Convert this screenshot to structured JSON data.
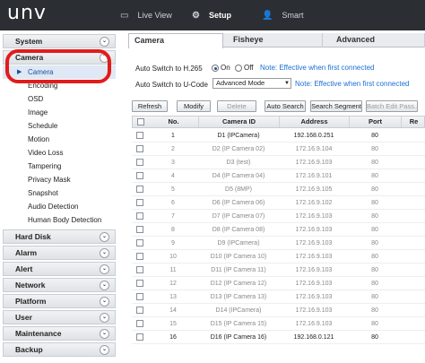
{
  "app": {
    "logo": "unv"
  },
  "topnav": [
    {
      "icon": "monitor-icon",
      "label": "Live View"
    },
    {
      "icon": "gear-icon",
      "label": "Setup"
    },
    {
      "icon": "person-icon",
      "label": "Smart"
    }
  ],
  "sidebar": {
    "sections_top": [
      {
        "label": "System"
      },
      {
        "label": "Camera"
      }
    ],
    "camera_items": [
      "Camera",
      "Encoding",
      "OSD",
      "Image",
      "Schedule",
      "Motion",
      "Video Loss",
      "Tampering",
      "Privacy Mask",
      "Snapshot",
      "Audio Detection",
      "Human Body Detection"
    ],
    "active_item": "Camera",
    "sections_bottom": [
      "Hard Disk",
      "Alarm",
      "Alert",
      "Network",
      "Platform",
      "User",
      "Maintenance",
      "Backup"
    ]
  },
  "tabs": [
    "Camera",
    "Fisheye",
    "Advanced"
  ],
  "settings": {
    "h265_label": "Auto Switch to H.265",
    "h265_on": "On",
    "h265_off": "Off",
    "h265_note": "Note: Effective when first connected",
    "ucode_label": "Auto Switch to U-Code",
    "ucode_value": "Advanced Mode",
    "ucode_note": "Note: Effective when first connected"
  },
  "buttons": {
    "refresh": "Refresh",
    "modify": "Modify",
    "delete": "Delete",
    "auto_search": "Auto Search",
    "search_segment": "Search Segment",
    "batch_edit": "Batch Edit Pass..."
  },
  "table": {
    "headers": [
      "No.",
      "Camera ID",
      "Address",
      "Port",
      "Re"
    ],
    "rows": [
      {
        "no": "1",
        "id": "D1 (IPCamera)",
        "addr": "192.168.0.251",
        "port": "80",
        "online": true
      },
      {
        "no": "2",
        "id": "D2 (IP Camera 02)",
        "addr": "172.16.9.104",
        "port": "80",
        "online": false
      },
      {
        "no": "3",
        "id": "D3 (test)",
        "addr": "172.16.9.103",
        "port": "80",
        "online": false
      },
      {
        "no": "4",
        "id": "D4 (IP Camera 04)",
        "addr": "172.16.9.101",
        "port": "80",
        "online": false
      },
      {
        "no": "5",
        "id": "D5 (8MP)",
        "addr": "172.16.9.105",
        "port": "80",
        "online": false
      },
      {
        "no": "6",
        "id": "D6 (IP Camera 06)",
        "addr": "172.16.9.102",
        "port": "80",
        "online": false
      },
      {
        "no": "7",
        "id": "D7 (IP Camera 07)",
        "addr": "172.16.9.103",
        "port": "80",
        "online": false
      },
      {
        "no": "8",
        "id": "D8 (IP Camera 08)",
        "addr": "172.16.9.103",
        "port": "80",
        "online": false
      },
      {
        "no": "9",
        "id": "D9 (IPCamera)",
        "addr": "172.16.9.103",
        "port": "80",
        "online": false
      },
      {
        "no": "10",
        "id": "D10 (IP Camera 10)",
        "addr": "172.16.9.103",
        "port": "80",
        "online": false
      },
      {
        "no": "11",
        "id": "D11 (IP Camera 11)",
        "addr": "172.16.9.103",
        "port": "80",
        "online": false
      },
      {
        "no": "12",
        "id": "D12 (IP Camera 12)",
        "addr": "172.16.9.103",
        "port": "80",
        "online": false
      },
      {
        "no": "13",
        "id": "D13 (IP Camera 13)",
        "addr": "172.16.9.103",
        "port": "80",
        "online": false
      },
      {
        "no": "14",
        "id": "D14 (IPCamera)",
        "addr": "172.16.9.103",
        "port": "80",
        "online": false
      },
      {
        "no": "15",
        "id": "D15 (IP Camera 15)",
        "addr": "172.16.9.103",
        "port": "80",
        "online": false
      },
      {
        "no": "16",
        "id": "D16 (IP Camera 16)",
        "addr": "192.168.0.121",
        "port": "80",
        "online": true
      }
    ]
  },
  "colors": {
    "topbar": "#2b2e33",
    "note": "#1a6fd0",
    "highlight": "#e21b1b"
  }
}
